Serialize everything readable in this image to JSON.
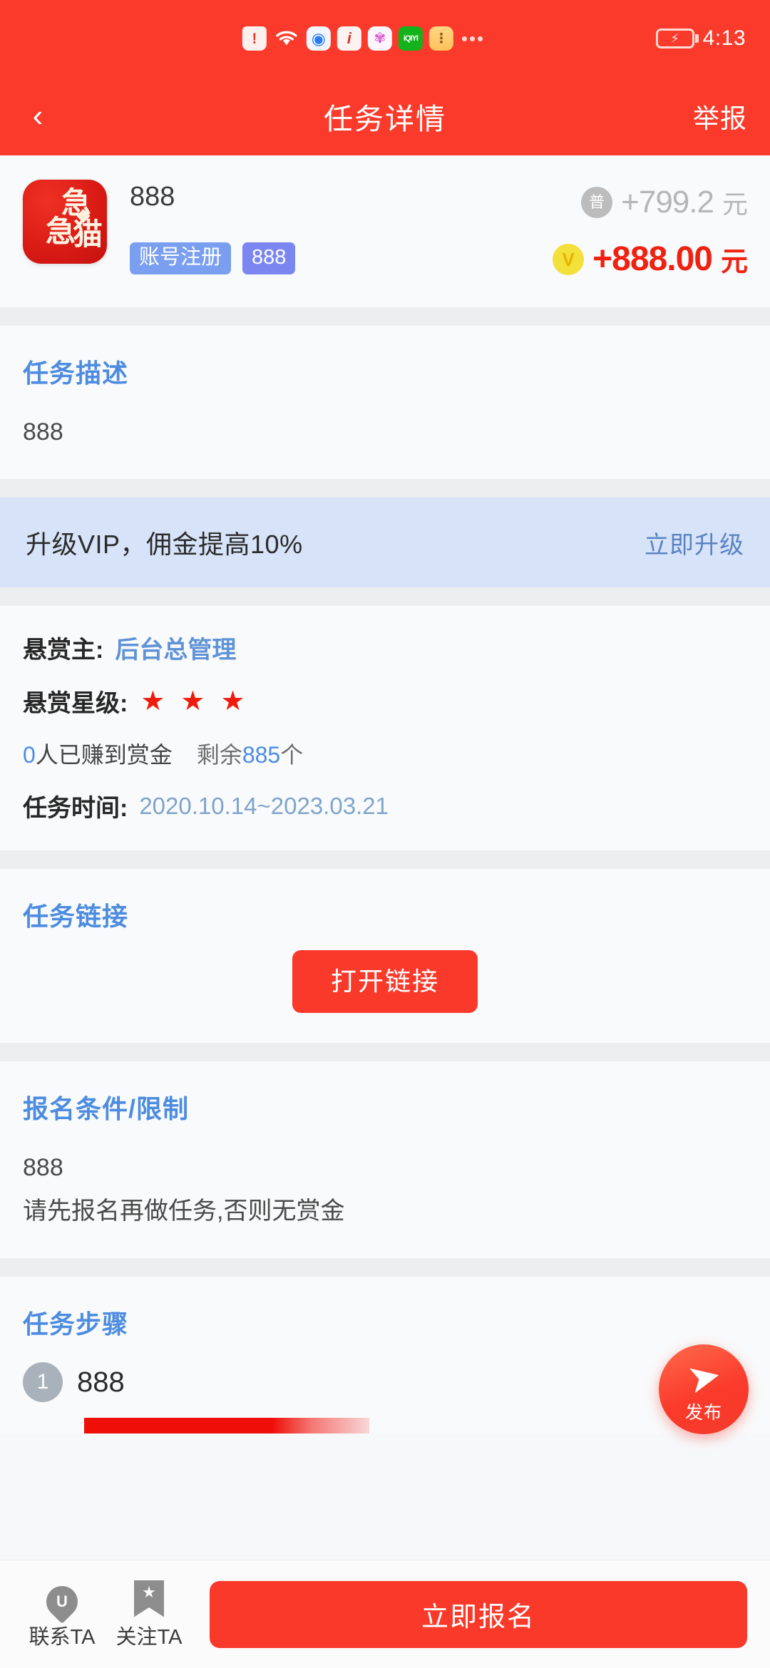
{
  "status_bar": {
    "time": "4:13",
    "icons": [
      {
        "name": "sim-alert-icon",
        "glyph": "!"
      },
      {
        "name": "wifi-icon",
        "glyph": "≋"
      },
      {
        "name": "browser-icon",
        "glyph": "◉"
      },
      {
        "name": "info-icon",
        "glyph": "i"
      },
      {
        "name": "photos-icon",
        "glyph": "✾"
      },
      {
        "name": "iqiyi-icon",
        "glyph": "iQIYI"
      },
      {
        "name": "notes-icon",
        "glyph": "⋮"
      }
    ],
    "overflow": "•••",
    "battery_glyph": "⚡"
  },
  "title_bar": {
    "back_glyph": "‹",
    "title": "任务详情",
    "report_label": "举报"
  },
  "task_head": {
    "logo_chars": [
      "急",
      "急",
      "猫"
    ],
    "title": "888",
    "tags": [
      {
        "label": "账号注册",
        "style": "cat"
      },
      {
        "label": "888",
        "style": "num"
      }
    ],
    "price_normal": {
      "badge": "普",
      "amount": "+799.2",
      "unit": "元"
    },
    "price_vip": {
      "badge": "V",
      "amount": "+888.00",
      "unit": "元"
    }
  },
  "description": {
    "title": "任务描述",
    "body": "888"
  },
  "vip_banner": {
    "text": "升级VIP，佣金提高10%",
    "action": "立即升级"
  },
  "bounty_info": {
    "owner_label": "悬赏主:",
    "owner_value": "后台总管理",
    "stars_label": "悬赏星级:",
    "stars": [
      "★",
      "★",
      "★"
    ],
    "earned_count": "0",
    "earned_text": "人已赚到赏金",
    "remain_prefix": "剩余",
    "remain_count": "885",
    "remain_suffix": "个",
    "time_label": "任务时间:",
    "time_value": "2020.10.14~2023.03.21"
  },
  "task_link": {
    "title": "任务链接",
    "button": "打开链接"
  },
  "conditions": {
    "title": "报名条件/限制",
    "line1": "888",
    "line2": "请先报名再做任务,否则无赏金"
  },
  "steps": {
    "title": "任务步骤",
    "items": [
      {
        "number": "1",
        "text": "888"
      }
    ]
  },
  "fab": {
    "icon": "➤",
    "label": "发布"
  },
  "bottom_bar": {
    "contact_label": "联系TA",
    "follow_label": "关注TA",
    "cta_label": "立即报名"
  },
  "colors": {
    "brand_red": "#fa3b2b",
    "accent_blue": "#4d8ce0",
    "vip_banner_bg": "#d7e3f8",
    "vip_badge": "#f4e03a",
    "price_red": "#ef2211"
  }
}
